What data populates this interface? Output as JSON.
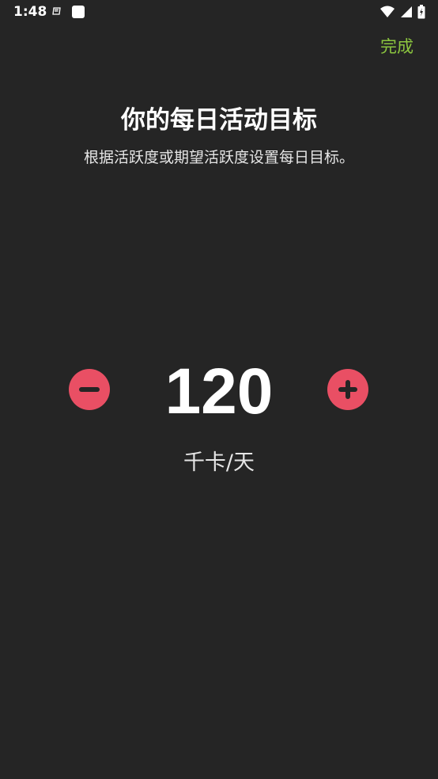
{
  "status_bar": {
    "time": "1:48",
    "left_icons": [
      "notification-icon",
      "app-square-icon"
    ],
    "right_icons": [
      "wifi-icon",
      "signal-icon",
      "battery-icon"
    ]
  },
  "header": {
    "done_label": "完成"
  },
  "main": {
    "title": "你的每日活动目标",
    "subtitle": "根据活跃度或期望活跃度设置每日目标。",
    "goal_value": "120",
    "goal_unit": "千卡/天"
  },
  "colors": {
    "background": "#252525",
    "accent_green": "#8cc63f",
    "stepper": "#e94f64"
  }
}
